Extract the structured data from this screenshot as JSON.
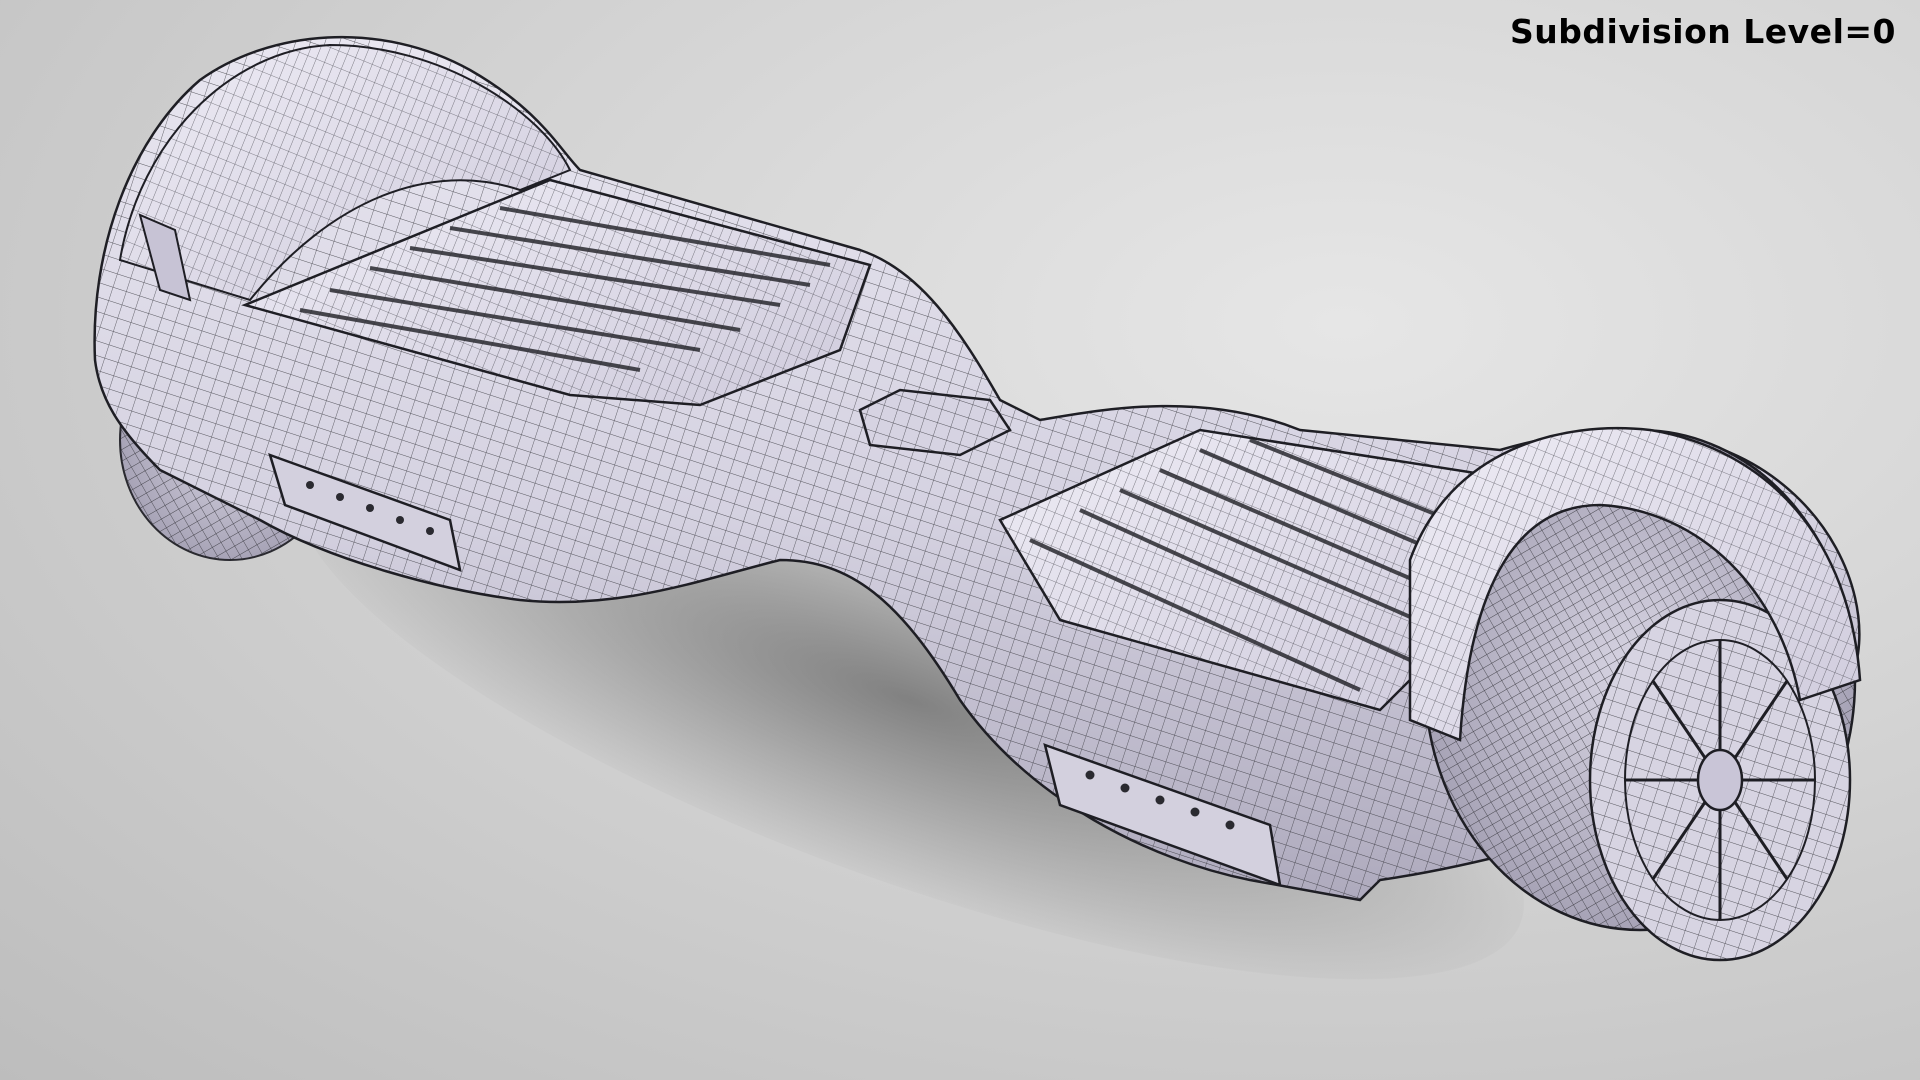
{
  "overlay": {
    "label": "Subdivision Level=0"
  },
  "scene": {
    "subject": "hoverboard-wireframe-render",
    "colors": {
      "background": "#d4d4d4",
      "mesh_fill": "#dcdae6",
      "mesh_shade": "#b9b6c8",
      "wire": "#2a2a30",
      "label": "#000000"
    }
  }
}
